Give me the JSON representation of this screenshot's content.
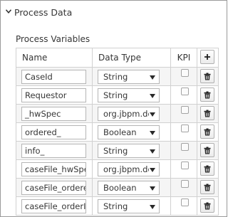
{
  "section": {
    "title": "Process Data",
    "chevron_icon": "chevron-down-icon"
  },
  "variables": {
    "title": "Process Variables",
    "columns": {
      "name": "Name",
      "data_type": "Data Type",
      "kpi": "KPI"
    },
    "add_icon": "plus-icon",
    "delete_icon": "trash-icon",
    "rows": [
      {
        "name": "CaseId",
        "data_type": "String",
        "kpi": false
      },
      {
        "name": "Requestor",
        "data_type": "String",
        "kpi": false
      },
      {
        "name": "_hwSpec",
        "data_type": "org.jbpm.doc",
        "kpi": false
      },
      {
        "name": "ordered_",
        "data_type": "Boolean",
        "kpi": false
      },
      {
        "name": "info_",
        "data_type": "String",
        "kpi": false
      },
      {
        "name": "caseFile_hwSpec",
        "data_type": "org.jbpm.doc",
        "kpi": false
      },
      {
        "name": "caseFile_ordered",
        "data_type": "Boolean",
        "kpi": false
      },
      {
        "name": "caseFile_orderInf",
        "data_type": "String",
        "kpi": false
      }
    ]
  }
}
